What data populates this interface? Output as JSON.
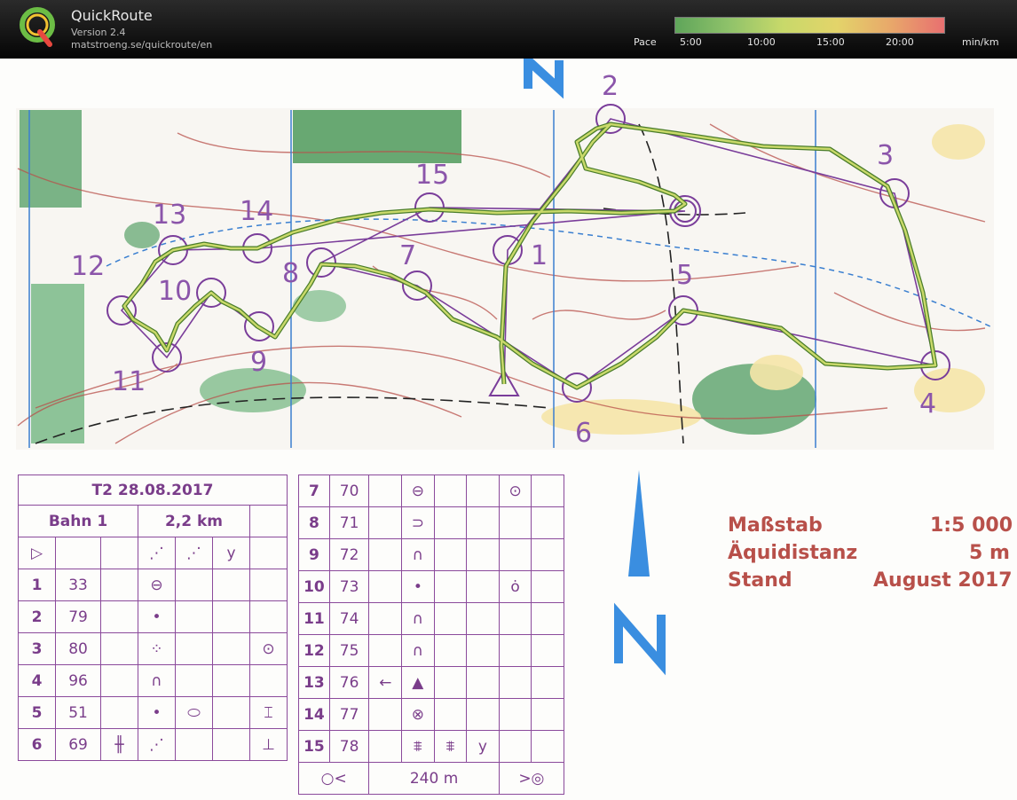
{
  "app": {
    "title": "QuickRoute",
    "version": "Version 2.4",
    "url": "matstroeng.se/quickroute/en"
  },
  "pace_scale": {
    "label": "Pace",
    "ticks": [
      "5:00",
      "10:00",
      "15:00",
      "20:00"
    ],
    "unit": "min/km",
    "colors": [
      "#5fa55a",
      "#8fc26a",
      "#c8d96a",
      "#e3d46a",
      "#e8a86a",
      "#e87070"
    ]
  },
  "course": {
    "date_title": "T2 28.08.2017",
    "name": "Bahn 1",
    "length": "2,2 km",
    "controls_left": [
      {
        "num": "1",
        "code": "33"
      },
      {
        "num": "2",
        "code": "79"
      },
      {
        "num": "3",
        "code": "80"
      },
      {
        "num": "4",
        "code": "96"
      },
      {
        "num": "5",
        "code": "51"
      },
      {
        "num": "6",
        "code": "69"
      }
    ],
    "controls_right": [
      {
        "num": "7",
        "code": "70"
      },
      {
        "num": "8",
        "code": "71"
      },
      {
        "num": "9",
        "code": "72"
      },
      {
        "num": "10",
        "code": "73"
      },
      {
        "num": "11",
        "code": "74"
      },
      {
        "num": "12",
        "code": "75"
      },
      {
        "num": "13",
        "code": "76"
      },
      {
        "num": "14",
        "code": "77"
      },
      {
        "num": "15",
        "code": "78"
      }
    ],
    "finish_distance": "240 m",
    "map_labels": [
      "1",
      "2",
      "3",
      "4",
      "5",
      "6",
      "7",
      "8",
      "9",
      "10",
      "11",
      "12",
      "13",
      "14",
      "15"
    ]
  },
  "map_info": {
    "scale_label": "Maßstab",
    "scale_value": "1:5 000",
    "contour_label": "Äquidistanz",
    "contour_value": "5 m",
    "date_label": "Stand",
    "date_value": "August 2017"
  }
}
